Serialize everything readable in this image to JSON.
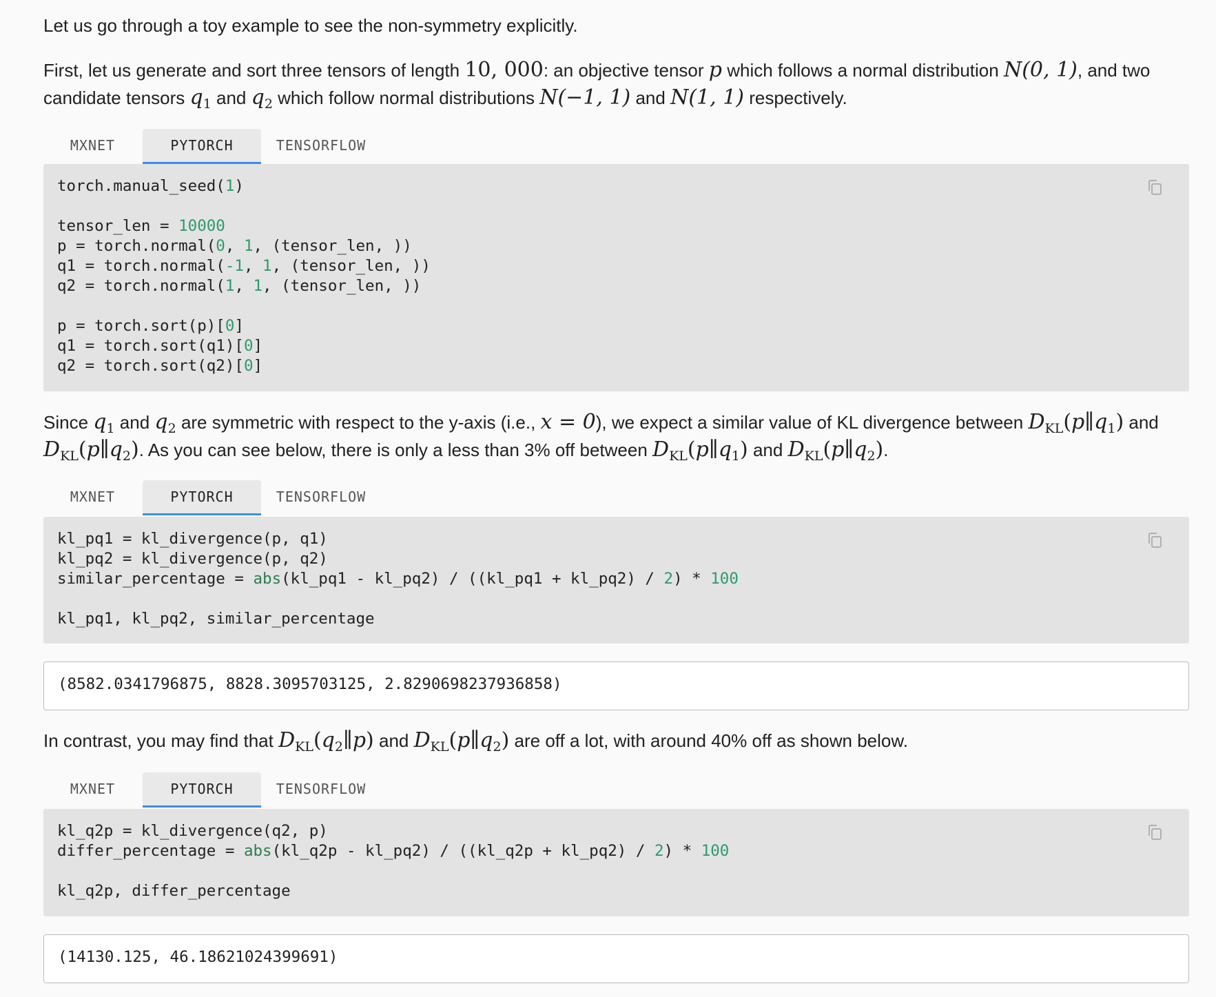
{
  "intro": "Let us go through a toy example to see the non-symmetry explicitly.",
  "para1": {
    "t1": "First, let us generate and sort three tensors of length ",
    "m_len": "10, 000",
    "t2": ": an objective tensor ",
    "m_p": "p",
    "t3": " which follows a normal distribution ",
    "m_n01": "N(0, 1)",
    "t4": ", and two candidate tensors ",
    "t5": " and ",
    "t6": " which follow normal distributions ",
    "m_nm11": "N(−1, 1)",
    "t7": " and ",
    "m_n11": "N(1, 1)",
    "t8": " respectively."
  },
  "para2": {
    "t1": "Since ",
    "t2": " and ",
    "t3": " are symmetric with respect to the y-axis (i.e., ",
    "m_x0": "x = 0",
    "t4": "), we expect a similar value of KL divergence between ",
    "t5": " and",
    "t6": ". As you can see below, there is only a less than 3% off between ",
    "t7": " and ",
    "t8": "."
  },
  "para3": {
    "t1": "In contrast, you may find that ",
    "t2": " and ",
    "t3": " are off a lot, with around 40% off as shown below."
  },
  "math": {
    "D": "D",
    "KL": "KL",
    "q": "q",
    "sub1": "1",
    "sub2": "2",
    "p": "p",
    "open": "(",
    "close": ")",
    "bars": "∥"
  },
  "tabs": [
    "MXNET",
    "PYTORCH",
    "TENSORFLOW"
  ],
  "active_tab": "PYTORCH",
  "code1": [
    "torch.manual_seed(1)",
    "",
    "tensor_len = 10000",
    "p = torch.normal(0, 1, (tensor_len, ))",
    "q1 = torch.normal(-1, 1, (tensor_len, ))",
    "q2 = torch.normal(1, 1, (tensor_len, ))",
    "",
    "p = torch.sort(p)[0]",
    "q1 = torch.sort(q1)[0]",
    "q2 = torch.sort(q2)[0]"
  ],
  "code2": [
    "kl_pq1 = kl_divergence(p, q1)",
    "kl_pq2 = kl_divergence(p, q2)",
    "similar_percentage = abs(kl_pq1 - kl_pq2) / ((kl_pq1 + kl_pq2) / 2) * 100",
    "",
    "kl_pq1, kl_pq2, similar_percentage"
  ],
  "output2": "(8582.0341796875, 8828.3095703125, 2.8290698237936858)",
  "code3": [
    "kl_q2p = kl_divergence(q2, p)",
    "differ_percentage = abs(kl_q2p - kl_pq2) / ((kl_q2p + kl_pq2) / 2) * 100",
    "",
    "kl_q2p, differ_percentage"
  ],
  "output3": "(14130.125, 46.18621024399691)",
  "icons": {
    "copy": "copy-icon"
  },
  "colors": {
    "accent": "#3a8ee6",
    "number": "#2e9a6b",
    "code_bg": "#e3e3e3"
  }
}
